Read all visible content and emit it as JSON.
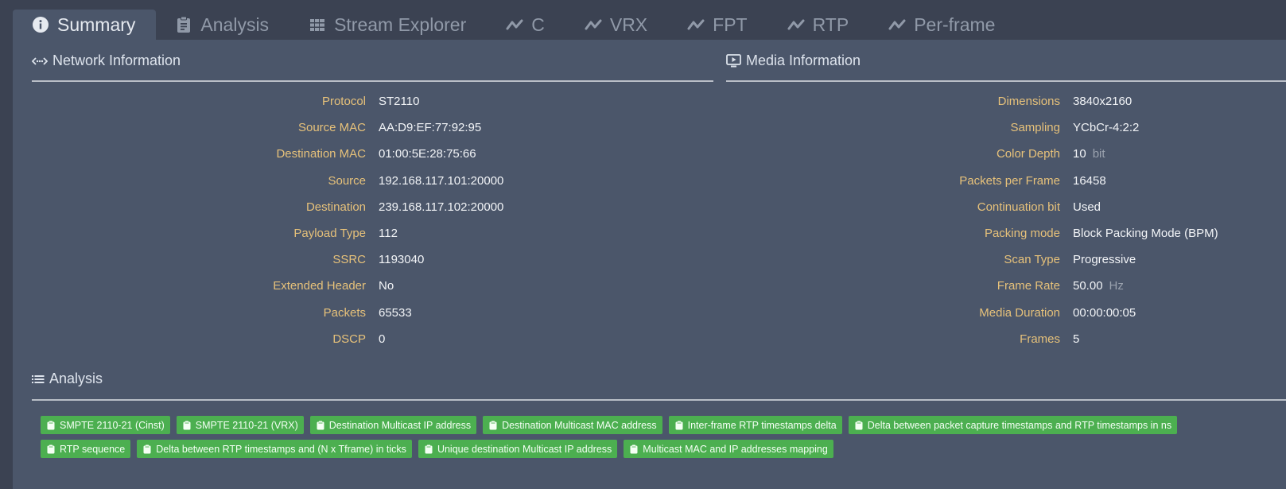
{
  "tabs": [
    {
      "label": "Summary",
      "icon": "info-circle-icon",
      "active": true
    },
    {
      "label": "Analysis",
      "icon": "clipboard-icon",
      "active": false
    },
    {
      "label": "Stream Explorer",
      "icon": "grid-icon",
      "active": false
    },
    {
      "label": "C",
      "icon": "line-chart-icon",
      "active": false
    },
    {
      "label": "VRX",
      "icon": "line-chart-icon",
      "active": false
    },
    {
      "label": "FPT",
      "icon": "line-chart-icon",
      "active": false
    },
    {
      "label": "RTP",
      "icon": "line-chart-icon",
      "active": false
    },
    {
      "label": "Per-frame",
      "icon": "line-chart-icon",
      "active": false
    }
  ],
  "network": {
    "title": "Network Information",
    "rows": [
      {
        "key": "Protocol",
        "value": "ST2110"
      },
      {
        "key": "Source MAC",
        "value": "AA:D9:EF:77:92:95"
      },
      {
        "key": "Destination MAC",
        "value": "01:00:5E:28:75:66"
      },
      {
        "key": "Source",
        "value": "192.168.117.101:20000"
      },
      {
        "key": "Destination",
        "value": "239.168.117.102:20000"
      },
      {
        "key": "Payload Type",
        "value": "112"
      },
      {
        "key": "SSRC",
        "value": "1193040"
      },
      {
        "key": "Extended Header",
        "value": "No"
      },
      {
        "key": "Packets",
        "value": "65533"
      },
      {
        "key": "DSCP",
        "value": "0"
      }
    ]
  },
  "media": {
    "title": "Media Information",
    "rows": [
      {
        "key": "Dimensions",
        "value": "3840x2160"
      },
      {
        "key": "Sampling",
        "value": "YCbCr-4:2:2"
      },
      {
        "key": "Color Depth",
        "value": "10",
        "unit": "bit"
      },
      {
        "key": "Packets per Frame",
        "value": "16458"
      },
      {
        "key": "Continuation bit",
        "value": "Used"
      },
      {
        "key": "Packing mode",
        "value": "Block Packing Mode (BPM)"
      },
      {
        "key": "Scan Type",
        "value": "Progressive"
      },
      {
        "key": "Frame Rate",
        "value": "50.00",
        "unit": "Hz"
      },
      {
        "key": "Media Duration",
        "value": "00:00:00:05"
      },
      {
        "key": "Frames",
        "value": "5"
      }
    ]
  },
  "analysis": {
    "title": "Analysis",
    "badges": [
      "SMPTE 2110-21 (Cinst)",
      "SMPTE 2110-21 (VRX)",
      "Destination Multicast IP address",
      "Destination Multicast MAC address",
      "Inter-frame RTP timestamps delta",
      "Delta between packet capture timestamps and RTP timestamps in ns",
      "RTP sequence",
      "Delta between RTP timestamps and (N x Tframe) in ticks",
      "Unique destination Multicast IP address",
      "Multicast MAC and IP addresses mapping"
    ],
    "badge_color": "#4caf50"
  },
  "colors": {
    "background": "#3b4252",
    "panel": "#4b566a",
    "key_text": "#e6c17a",
    "value_text": "#f2f4f7"
  }
}
